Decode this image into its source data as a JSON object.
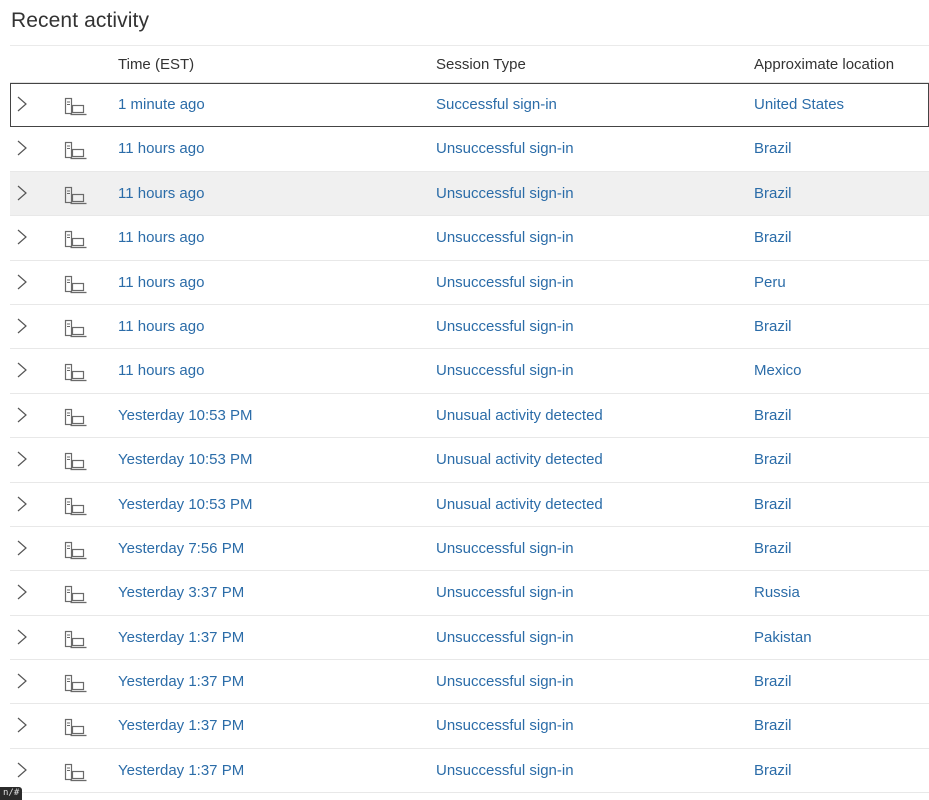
{
  "page": {
    "title": "Recent activity"
  },
  "table": {
    "headers": {
      "time": "Time (EST)",
      "type": "Session Type",
      "location": "Approximate location"
    },
    "rows": [
      {
        "time": "1 minute ago",
        "type": "Successful sign-in",
        "location": "United States"
      },
      {
        "time": "11 hours ago",
        "type": "Unsuccessful sign-in",
        "location": "Brazil"
      },
      {
        "time": "11 hours ago",
        "type": "Unsuccessful sign-in",
        "location": "Brazil"
      },
      {
        "time": "11 hours ago",
        "type": "Unsuccessful sign-in",
        "location": "Brazil"
      },
      {
        "time": "11 hours ago",
        "type": "Unsuccessful sign-in",
        "location": "Peru"
      },
      {
        "time": "11 hours ago",
        "type": "Unsuccessful sign-in",
        "location": "Brazil"
      },
      {
        "time": "11 hours ago",
        "type": "Unsuccessful sign-in",
        "location": "Mexico"
      },
      {
        "time": "Yesterday 10:53 PM",
        "type": "Unusual activity detected",
        "location": "Brazil"
      },
      {
        "time": "Yesterday 10:53 PM",
        "type": "Unusual activity detected",
        "location": "Brazil"
      },
      {
        "time": "Yesterday 10:53 PM",
        "type": "Unusual activity detected",
        "location": "Brazil"
      },
      {
        "time": "Yesterday 7:56 PM",
        "type": "Unsuccessful sign-in",
        "location": "Brazil"
      },
      {
        "time": "Yesterday 3:37 PM",
        "type": "Unsuccessful sign-in",
        "location": "Russia"
      },
      {
        "time": "Yesterday 1:37 PM",
        "type": "Unsuccessful sign-in",
        "location": "Pakistan"
      },
      {
        "time": "Yesterday 1:37 PM",
        "type": "Unsuccessful sign-in",
        "location": "Brazil"
      },
      {
        "time": "Yesterday 1:37 PM",
        "type": "Unsuccessful sign-in",
        "location": "Brazil"
      },
      {
        "time": "Yesterday 1:37 PM",
        "type": "Unsuccessful sign-in",
        "location": "Brazil"
      }
    ],
    "selected_row": 0,
    "hovered_row": 2
  },
  "icons": {
    "expand": "chevron-right-icon",
    "device": "computer-device-icon"
  },
  "colors": {
    "link": "#2b6ca8",
    "text": "#333333",
    "hover_bg": "#f0f0f0",
    "row_divider": "#e8e8e8"
  },
  "status_bar": {
    "url_fragment": "n/#"
  }
}
